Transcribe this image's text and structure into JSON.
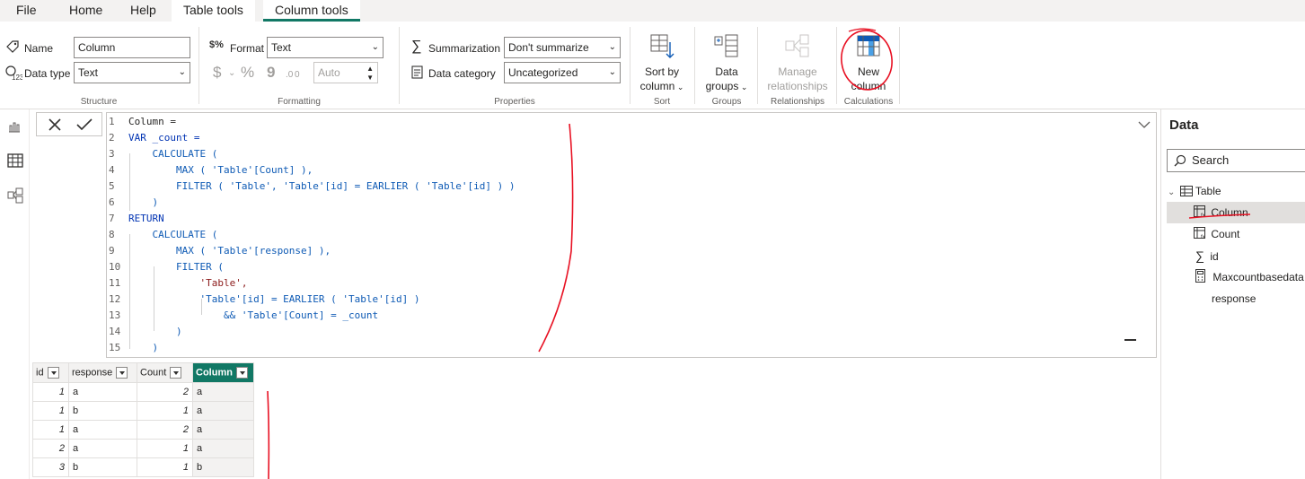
{
  "tabs": [
    "File",
    "Home",
    "Help",
    "Table tools",
    "Column tools"
  ],
  "active_tab": "Column tools",
  "structure": {
    "name_label": "Name",
    "name_value": "Column",
    "datatype_label": "Data type",
    "datatype_value": "Text",
    "group_label": "Structure"
  },
  "formatting": {
    "format_label": "Format",
    "format_value": "Text",
    "currency_symbol": "$",
    "percent_symbol": "%",
    "comma_symbol": "9",
    "decimals_value": "Auto",
    "group_label": "Formatting"
  },
  "properties": {
    "summarization_label": "Summarization",
    "summarization_value": "Don't summarize",
    "category_label": "Data category",
    "category_value": "Uncategorized",
    "group_label": "Properties"
  },
  "sort": {
    "button_line1": "Sort by",
    "button_line2": "column",
    "group_label": "Sort"
  },
  "groups": {
    "button_line1": "Data",
    "button_line2": "groups",
    "group_label": "Groups"
  },
  "relationships": {
    "button_line1": "Manage",
    "button_line2": "relationships",
    "group_label": "Relationships"
  },
  "calculations": {
    "button_line1": "New",
    "button_line2": "column",
    "group_label": "Calculations"
  },
  "formula": {
    "lines": [
      "Column =",
      "VAR _count =",
      "    CALCULATE (",
      "        MAX ( 'Table'[Count] ),",
      "        FILTER ( 'Table', 'Table'[id] = EARLIER ( 'Table'[id] ) )",
      "    )",
      "RETURN",
      "    CALCULATE (",
      "        MAX ( 'Table'[response] ),",
      "        FILTER (",
      "            'Table',",
      "            'Table'[id] = EARLIER ( 'Table'[id] )",
      "                && 'Table'[Count] = _count",
      "        )",
      "    )"
    ],
    "line_numbers": [
      "1",
      "2",
      "3",
      "4",
      "5",
      "6",
      "7",
      "8",
      "9",
      "10",
      "11",
      "12",
      "13",
      "14",
      "15"
    ]
  },
  "table": {
    "columns": [
      "id",
      "response",
      "Count",
      "Column"
    ],
    "selected_column": "Column",
    "rows": [
      [
        "1",
        "a",
        "2",
        "a"
      ],
      [
        "1",
        "b",
        "1",
        "a"
      ],
      [
        "1",
        "a",
        "2",
        "a"
      ],
      [
        "2",
        "a",
        "1",
        "a"
      ],
      [
        "3",
        "b",
        "1",
        "b"
      ]
    ]
  },
  "data_pane": {
    "title": "Data",
    "search_placeholder": "Search",
    "table_name": "Table",
    "fields": [
      "Column",
      "Count",
      "id",
      "Maxcountbasedata",
      "response"
    ],
    "selected_field": "Column"
  },
  "colors": {
    "accent": "#117865",
    "annotation": "#e81123"
  }
}
